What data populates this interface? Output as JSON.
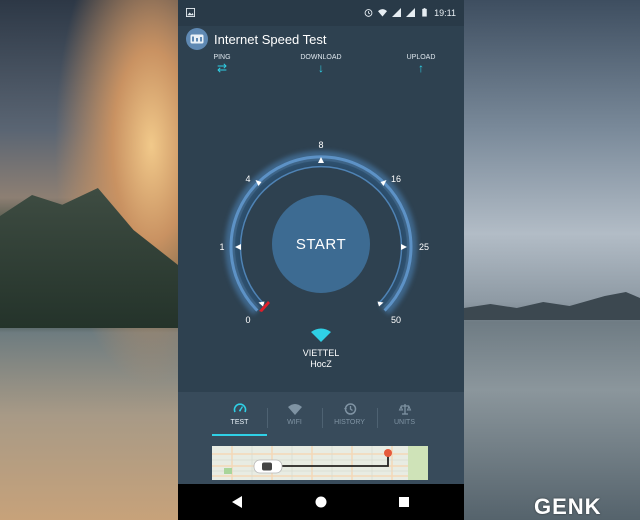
{
  "status_bar": {
    "time": "19:11"
  },
  "app": {
    "title": "Internet Speed Test"
  },
  "metrics": [
    {
      "label": "PING",
      "icon": "swap-arrows-icon"
    },
    {
      "label": "DOWNLOAD",
      "icon": "arrow-down-icon"
    },
    {
      "label": "UPLOAD",
      "icon": "arrow-up-icon"
    }
  ],
  "gauge": {
    "ticks": [
      "0",
      "1",
      "4",
      "8",
      "16",
      "25",
      "50"
    ],
    "start_label": "START",
    "accent_color": "#2fd0e6",
    "needle_color": "#e01e2a"
  },
  "network": {
    "isp": "VIETTEL",
    "name": "HocZ"
  },
  "tabs": [
    {
      "label": "TEST",
      "icon": "speedometer-icon",
      "active": true
    },
    {
      "label": "WIFI",
      "icon": "wifi-icon",
      "active": false
    },
    {
      "label": "HISTORY",
      "icon": "history-icon",
      "active": false
    },
    {
      "label": "UNITS",
      "icon": "units-icon",
      "active": false
    }
  ],
  "watermark": "GENK"
}
